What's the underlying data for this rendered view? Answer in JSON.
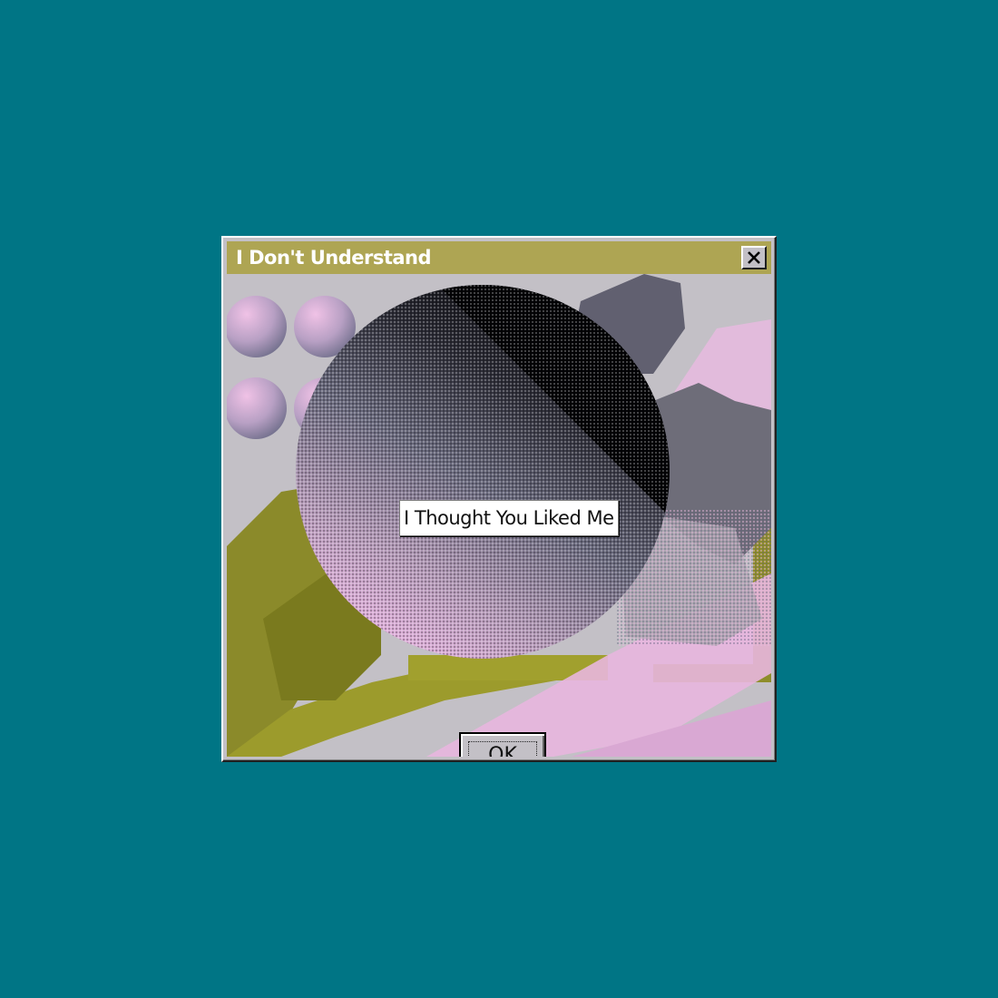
{
  "window": {
    "title": "I Don't Understand",
    "close_icon": "close-x-icon"
  },
  "message": {
    "text": "I Thought You Liked Me"
  },
  "buttons": {
    "ok_label": "OK"
  },
  "colors": {
    "desktop": "#007585",
    "titlebar": "#aea553",
    "dialog_face": "#c3c0c6",
    "pink": "#e7b3df",
    "olive": "#8b8a2a"
  }
}
